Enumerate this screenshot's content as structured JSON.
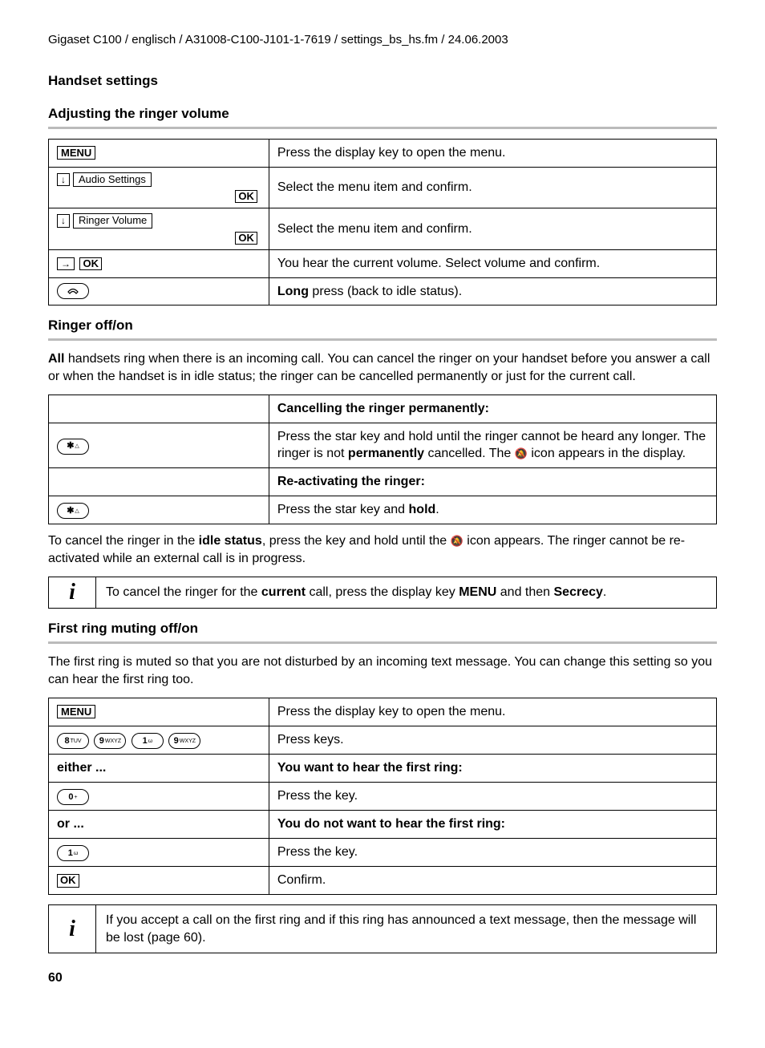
{
  "header": "Gigaset C100 / englisch / A31008-C100-J101-1-7619 / settings_bs_hs.fm / 24.06.2003",
  "page_number": "60",
  "section_title": "Handset settings",
  "s1": {
    "title": "Adjusting the ringer volume",
    "menu_label": "MENU",
    "row1_desc": "Press the display key to open the menu.",
    "row2_item": "Audio Settings",
    "row2_ok": "OK",
    "row2_desc": "Select the menu item and confirm.",
    "row3_item": "Ringer Volume",
    "row3_ok": "OK",
    "row3_desc": "Select the menu item and confirm.",
    "row4_ok": "OK",
    "row4_desc": "You hear the current volume. Select volume and confirm.",
    "row5_desc_strong": "Long",
    "row5_desc_rest": " press (back to idle status)."
  },
  "s2": {
    "title": "Ringer off/on",
    "intro_strong": "All",
    "intro_rest": " handsets ring when there is an incoming call. You can cancel the ringer on your handset before you answer a call or when the handset is in idle status; the ringer can be cancelled permanently or just for the current call.",
    "head1": "Cancelling the ringer permanently:",
    "row1_desc_a": "Press the star key and hold until the ringer cannot be heard any longer. The ringer is not ",
    "row1_desc_b": "permanently",
    "row1_desc_c": " cancelled. The ",
    "row1_desc_d": " icon appears in the display.",
    "head2": "Re-activating the ringer:",
    "row2_desc_a": "Press the star key and ",
    "row2_desc_b": "hold",
    "row2_desc_c": ".",
    "outro_a": "To cancel the ringer in the ",
    "outro_b": "idle status",
    "outro_c": ", press the key and hold until the ",
    "outro_d": " icon appears. The ringer cannot be re-activated while an external call is in progress.",
    "info_a": "To cancel the ringer for the ",
    "info_b": "current",
    "info_c": " call, press the display key ",
    "info_d": "MENU",
    "info_e": " and then ",
    "info_f": "Secrecy",
    "info_g": "."
  },
  "s3": {
    "title": "First ring muting off/on",
    "intro": "The first ring is muted so that you are not disturbed by an incoming text message. You can change this setting so you can hear the first ring too.",
    "menu_label": "MENU",
    "row1_desc": "Press the display key to open the menu.",
    "row2_desc": "Press keys.",
    "either_left": "either ...",
    "either_right": "You want to hear the first ring:",
    "row3_desc": "Press the key.",
    "or_left": "or ...",
    "or_right": "You do not want to hear the first ring:",
    "row4_desc": "Press the key.",
    "row5_ok": "OK",
    "row5_desc": "Confirm.",
    "info": "If you accept a call on the first ring and if this ring has announced a text message, then the message will be lost (page 60)."
  },
  "keys": {
    "star": "✱",
    "star_sub": "△",
    "hangup_icon": "↻",
    "k8": "8",
    "k8_sub": "TUV",
    "k9": "9",
    "k9_sub": "WXYZ",
    "k1": "1",
    "k1_sub": "ω",
    "k0": "0",
    "k0_sub": "+"
  }
}
